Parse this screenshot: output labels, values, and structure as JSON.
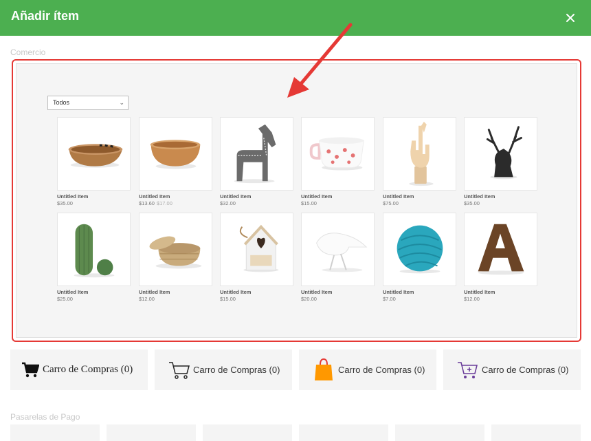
{
  "header": {
    "title": "Añadir ítem"
  },
  "sections": {
    "shop": "Comercio",
    "gateways": "Pasarelas de Pago"
  },
  "filter": {
    "selected": "Todos"
  },
  "products": [
    {
      "name": "Untitled Item",
      "price": "$35.00",
      "image": "striped-wooden-bowl"
    },
    {
      "name": "Untitled Item",
      "price": "$13.60",
      "old_price": "$17.00",
      "image": "wooden-bowl"
    },
    {
      "name": "Untitled Item",
      "price": "$32.00",
      "image": "gray-wooden-horse"
    },
    {
      "name": "Untitled Item",
      "price": "$15.00",
      "image": "floral-mug"
    },
    {
      "name": "Untitled Item",
      "price": "$75.00",
      "image": "wooden-hand"
    },
    {
      "name": "Untitled Item",
      "price": "$35.00",
      "image": "black-deer-head"
    },
    {
      "name": "Untitled Item",
      "price": "$25.00",
      "image": "ceramic-cactus"
    },
    {
      "name": "Untitled Item",
      "price": "$12.00",
      "image": "woven-basket"
    },
    {
      "name": "Untitled Item",
      "price": "$15.00",
      "image": "birdhouse-decor"
    },
    {
      "name": "Untitled Item",
      "price": "$20.00",
      "image": "white-bird"
    },
    {
      "name": "Untitled Item",
      "price": "$7.00",
      "image": "teal-yarn-ball"
    },
    {
      "name": "Untitled Item",
      "price": "$12.00",
      "image": "wooden-letter-a"
    }
  ],
  "carts": [
    {
      "label": "Carro de Compras (0)",
      "icon": "black-cart-icon"
    },
    {
      "label": "Carro de Compras (0)",
      "icon": "outline-cart-icon"
    },
    {
      "label": "Carro de Compras (0)",
      "icon": "orange-bag-icon"
    },
    {
      "label": "Carro de Compras (0)",
      "icon": "purple-cart-icon"
    }
  ],
  "colors": {
    "header": "#4caf50",
    "highlight": "#e53935",
    "arrow": "#e53935",
    "bag": "#ff9800",
    "cart_purple": "#6a3d9a"
  }
}
